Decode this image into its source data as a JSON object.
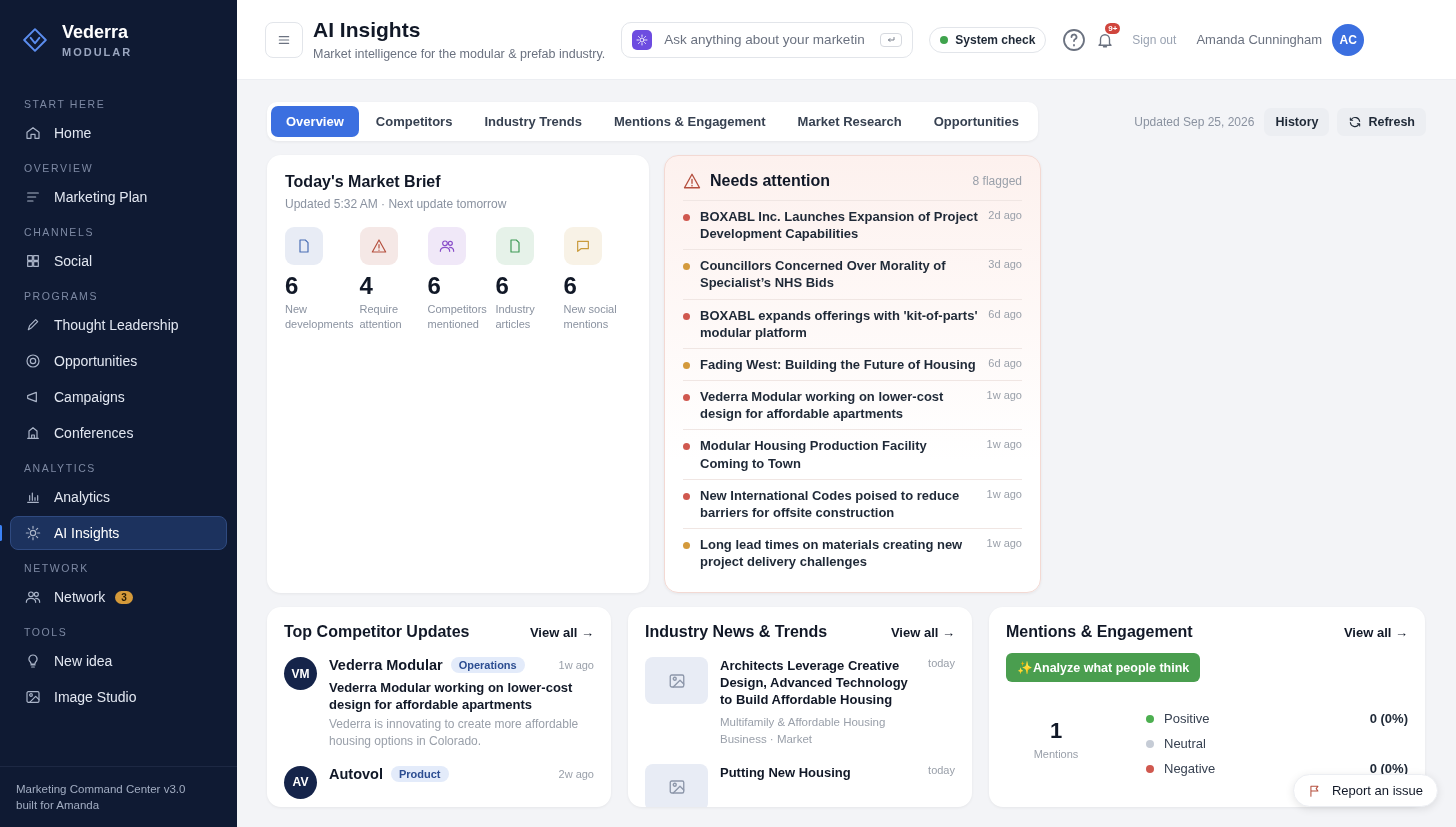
{
  "sidebar": {
    "brand": {
      "name": "Vederra",
      "subtitle": "MODULAR"
    },
    "sections": [
      {
        "heading": "START HERE",
        "items": [
          {
            "label": "Home",
            "selected": false
          }
        ]
      },
      {
        "heading": "OVERVIEW",
        "items": [
          {
            "label": "Marketing Plan",
            "selected": false
          }
        ]
      },
      {
        "heading": "CHANNELS",
        "items": [
          {
            "label": "Social",
            "selected": false
          }
        ]
      },
      {
        "heading": "PROGRAMS",
        "items": [
          {
            "label": "Thought Leadership",
            "selected": false
          },
          {
            "label": "Opportunities",
            "selected": false
          },
          {
            "label": "Campaigns",
            "selected": false
          },
          {
            "label": "Conferences",
            "selected": false
          }
        ]
      },
      {
        "heading": "ANALYTICS",
        "items": [
          {
            "label": "Analytics",
            "selected": false
          },
          {
            "label": "AI Insights",
            "selected": true
          }
        ]
      },
      {
        "heading": "NETWORK",
        "items": [
          {
            "label": "Network",
            "selected": false,
            "badge": "3"
          }
        ]
      },
      {
        "heading": "TOOLS",
        "items": [
          {
            "label": "New idea",
            "selected": false
          },
          {
            "label": "Image Studio",
            "selected": false
          }
        ]
      }
    ],
    "footer_lines": [
      "Marketing Command Center v3.0",
      "built for Amanda"
    ]
  },
  "header": {
    "title": "AI Insights",
    "subtitle": "Market intelligence for the modular & prefab industry.",
    "search": {
      "placeholder": "Ask anything about your marketin"
    },
    "status": "System check",
    "notifications_badge": "9+",
    "sign_out": "Sign out",
    "user": {
      "name": "Amanda Cunningham",
      "initials": "AC"
    }
  },
  "toolbar": {
    "tabs": [
      {
        "label": "Overview",
        "selected": true
      },
      {
        "label": "Competitors",
        "selected": false
      },
      {
        "label": "Industry Trends",
        "selected": false
      },
      {
        "label": "Mentions & Engagement",
        "selected": false
      },
      {
        "label": "Market Research",
        "selected": false
      },
      {
        "label": "Opportunities",
        "selected": false
      }
    ],
    "updated": "Updated Sep 25, 2026",
    "buttons": [
      {
        "label": "History",
        "kind": "plain"
      },
      {
        "label": "Refresh",
        "kind": "refresh"
      }
    ]
  },
  "market_brief": {
    "title": "Today's Market Brief",
    "subtitle": "Updated 5:32 AM · Next update tomorrow",
    "stats": [
      {
        "value": "6",
        "label": "New developments"
      },
      {
        "value": "4",
        "label": "Require attention"
      },
      {
        "value": "6",
        "label": "Competitors mentioned"
      },
      {
        "value": "6",
        "label": "Industry articles"
      },
      {
        "value": "6",
        "label": "New social mentions"
      }
    ]
  },
  "needs_attention": {
    "title": "Needs attention",
    "count": "8 flagged",
    "items": [
      {
        "title": "BOXABL Inc. Launches Expansion of Project Development Capabilities",
        "time": "2d ago",
        "color": "#d0584f"
      },
      {
        "title": "Councillors Concerned Over Morality of Specialist’s NHS Bids",
        "time": "3d ago",
        "color": "#d49a3c"
      },
      {
        "title": "BOXABL expands offerings with 'kit-of-parts' modular platform",
        "time": "6d ago",
        "color": "#d0584f"
      },
      {
        "title": "Fading West: Building the Future of Housing",
        "time": "6d ago",
        "color": "#d49a3c"
      },
      {
        "title": "Vederra Modular working on lower-cost design for affordable apartments",
        "time": "1w ago",
        "color": "#d0584f"
      },
      {
        "title": "Modular Housing Production Facility Coming to Town",
        "time": "1w ago",
        "color": "#d0584f"
      },
      {
        "title": "New International Codes poised to reduce barriers for offsite construction",
        "time": "1w ago",
        "color": "#d0584f"
      },
      {
        "title": "Long lead times on materials creating new project delivery challenges",
        "time": "1w ago",
        "color": "#d49a3c"
      }
    ]
  },
  "competitor_updates": {
    "title": "Top Competitor Updates",
    "link": "View all →",
    "items": [
      {
        "initials": "VM",
        "name": "Vederra Modular",
        "tag": "Operations",
        "time": "1w ago",
        "headline": "Vederra Modular working on lower-cost design for affordable apartments",
        "summary": "Vederra is innovating to create more affordable housing options in Colorado."
      },
      {
        "initials": "AV",
        "name": "Autovol",
        "tag": "Product",
        "time": "2w ago"
      }
    ]
  },
  "industry_news": {
    "title": "Industry News & Trends",
    "link": "View all →",
    "items": [
      {
        "headline": "Architects Leverage Creative Design, Advanced Technology to Build Affordable Housing",
        "source": "Multifamily & Affordable Housing Business · Market",
        "time": "today"
      },
      {
        "headline": "Putting New Housing",
        "time": "today"
      }
    ]
  },
  "mentions": {
    "title": "Mentions & Engagement",
    "link": "View all →",
    "action": "✨Analyze what people think",
    "total": "1",
    "total_label": "Mentions",
    "sentiment": [
      {
        "label": "Positive",
        "value": "0 (0%)",
        "color": "#4caf50"
      },
      {
        "label": "Neutral",
        "color": "#c6ccd6"
      },
      {
        "label": "Negative",
        "value": "0 (0%)",
        "color": "#d0584f"
      }
    ]
  },
  "report_button": "Report an issue"
}
